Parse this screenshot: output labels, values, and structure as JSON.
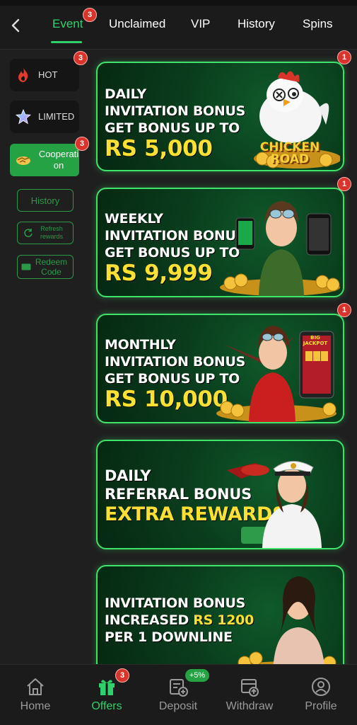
{
  "tabs": [
    {
      "label": "Event",
      "active": true,
      "badge": "3"
    },
    {
      "label": "Unclaimed"
    },
    {
      "label": "VIP"
    },
    {
      "label": "History"
    },
    {
      "label": "Spins"
    }
  ],
  "sidebar": {
    "categories": [
      {
        "label": "HOT",
        "icon": "flame-icon",
        "badge": "3"
      },
      {
        "label": "LIMITED",
        "icon": "star-icon"
      },
      {
        "label": "Cooperati on",
        "icon": "handshake-icon",
        "badge": "3",
        "active": true
      }
    ],
    "history_label": "History",
    "refresh_label": "Refresh rewards",
    "redeem_label": "Redeem Code"
  },
  "banners": [
    {
      "line1": "DAILY",
      "line2": "INVITATION BONUS",
      "line3": "GET BONUS UP TO",
      "amount": "RS 5,000",
      "badge": "1",
      "art_text": "CHICKEN ROAD"
    },
    {
      "line1": "WEEKLY",
      "line2": "INVITATION BONUS",
      "line3": "GET BONUS UP TO",
      "amount": "RS 9,999",
      "badge": "1"
    },
    {
      "line1": "MONTHLY",
      "line2": "INVITATION BONUS",
      "line3": "GET BONUS UP TO",
      "amount": "RS 10,000",
      "badge": "1",
      "art_text": "BIG JACKPOT"
    },
    {
      "line1": "DAILY",
      "line2": "REFERRAL BONUS",
      "highlight": "EXTRA REWARDS"
    },
    {
      "line1": "INVITATION BONUS",
      "line2a": "INCREASED ",
      "line2b": "RS 1200",
      "line3": "PER 1 DOWNLINE"
    }
  ],
  "bottom_nav": [
    {
      "label": "Home",
      "icon": "home-icon"
    },
    {
      "label": "Offers",
      "icon": "gift-icon",
      "active": true,
      "badge": "3"
    },
    {
      "label": "Deposit",
      "icon": "deposit-icon",
      "pill": "+5%"
    },
    {
      "label": "Withdraw",
      "icon": "withdraw-icon"
    },
    {
      "label": "Profile",
      "icon": "profile-icon"
    }
  ],
  "colors": {
    "accent": "#2fd26a",
    "badge": "#d9342b",
    "banner_border": "#3ee36a",
    "amount": "#ffe033"
  }
}
